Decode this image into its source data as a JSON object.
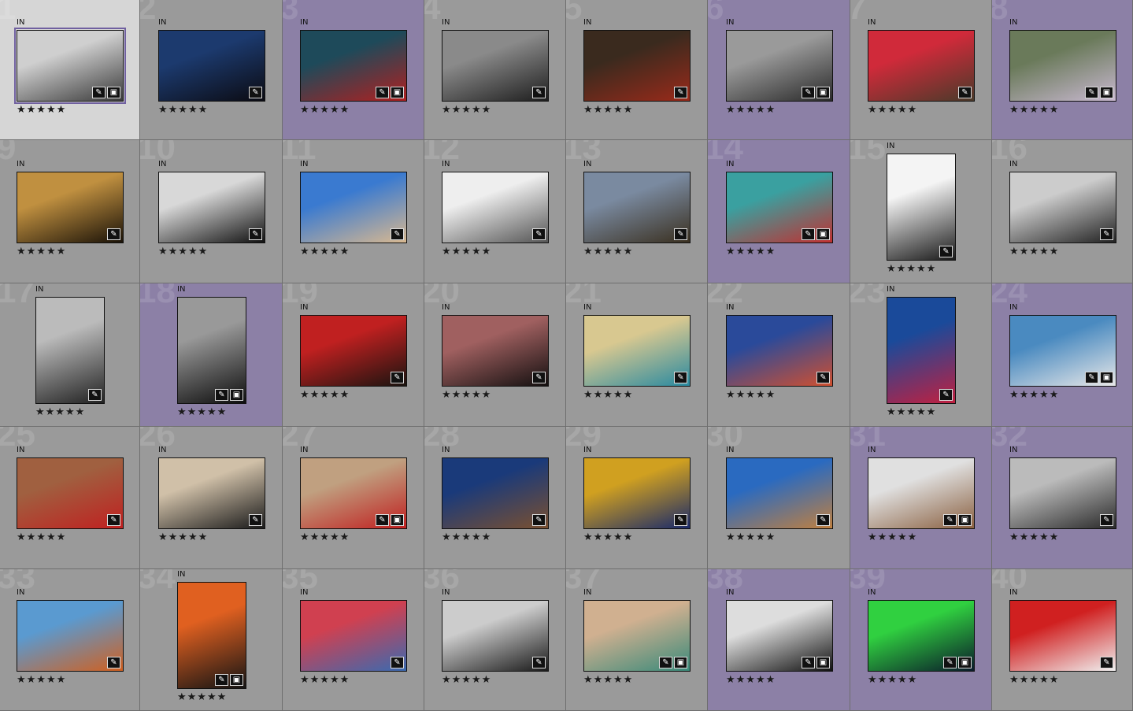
{
  "grid": {
    "columns": 8,
    "cells": [
      {
        "number": "1",
        "tag": "IN",
        "stars": "★★★★★",
        "state": "selected",
        "orientation": "landscape",
        "colors": [
          "#cfcfcf",
          "#3a3a3a"
        ],
        "badges": [
          "edit",
          "crop"
        ]
      },
      {
        "number": "2",
        "tag": "IN",
        "stars": "★★★★★",
        "state": "normal",
        "orientation": "landscape",
        "colors": [
          "#1c3a6e",
          "#0b0b12"
        ],
        "badges": [
          "edit"
        ]
      },
      {
        "number": "3",
        "tag": "IN",
        "stars": "★★★★★",
        "state": "purple",
        "orientation": "landscape",
        "colors": [
          "#1e4a5a",
          "#b02020"
        ],
        "badges": [
          "edit",
          "crop"
        ]
      },
      {
        "number": "4",
        "tag": "IN",
        "stars": "★★★★★",
        "state": "normal",
        "orientation": "landscape",
        "colors": [
          "#8a8a8a",
          "#1e1e1e"
        ],
        "badges": [
          "edit"
        ]
      },
      {
        "number": "5",
        "tag": "IN",
        "stars": "★★★★★",
        "state": "normal",
        "orientation": "landscape",
        "colors": [
          "#3a2a1e",
          "#9a2a1a"
        ],
        "badges": [
          "edit"
        ]
      },
      {
        "number": "6",
        "tag": "IN",
        "stars": "★★★★★",
        "state": "purple",
        "orientation": "landscape",
        "colors": [
          "#9a9a9a",
          "#2a2a2a"
        ],
        "badges": [
          "edit",
          "crop"
        ]
      },
      {
        "number": "7",
        "tag": "IN",
        "stars": "★★★★★",
        "state": "normal",
        "orientation": "landscape",
        "colors": [
          "#d02a3a",
          "#4a3a2a"
        ],
        "badges": [
          "edit"
        ]
      },
      {
        "number": "8",
        "tag": "IN",
        "stars": "★★★★★",
        "state": "purple",
        "orientation": "landscape",
        "colors": [
          "#6a7a5a",
          "#c8b8d0"
        ],
        "badges": [
          "edit",
          "crop"
        ]
      },
      {
        "number": "9",
        "tag": "IN",
        "stars": "★★★★★",
        "state": "normal",
        "orientation": "landscape",
        "colors": [
          "#c09040",
          "#1a1208"
        ],
        "badges": [
          "edit"
        ]
      },
      {
        "number": "10",
        "tag": "IN",
        "stars": "★★★★★",
        "state": "normal",
        "orientation": "landscape",
        "colors": [
          "#d8d8d8",
          "#111111"
        ],
        "badges": [
          "edit"
        ]
      },
      {
        "number": "11",
        "tag": "IN",
        "stars": "★★★★★",
        "state": "normal",
        "orientation": "landscape",
        "colors": [
          "#3a7ad0",
          "#d8b890"
        ],
        "badges": [
          "edit"
        ]
      },
      {
        "number": "12",
        "tag": "IN",
        "stars": "★★★★★",
        "state": "normal",
        "orientation": "landscape",
        "colors": [
          "#eeeeee",
          "#555555"
        ],
        "badges": [
          "edit"
        ]
      },
      {
        "number": "13",
        "tag": "IN",
        "stars": "★★★★★",
        "state": "normal",
        "orientation": "landscape",
        "colors": [
          "#7a8aa0",
          "#3a3020"
        ],
        "badges": [
          "edit"
        ]
      },
      {
        "number": "14",
        "tag": "IN",
        "stars": "★★★★★",
        "state": "purple",
        "orientation": "landscape",
        "colors": [
          "#3aa0a0",
          "#c03030"
        ],
        "badges": [
          "edit",
          "crop"
        ]
      },
      {
        "number": "15",
        "tag": "IN",
        "stars": "★★★★★",
        "state": "normal",
        "orientation": "portrait",
        "colors": [
          "#f4f4f4",
          "#1a1a1a"
        ],
        "badges": [
          "edit"
        ]
      },
      {
        "number": "16",
        "tag": "IN",
        "stars": "★★★★★",
        "state": "normal",
        "orientation": "landscape",
        "colors": [
          "#cccccc",
          "#222222"
        ],
        "badges": [
          "edit"
        ]
      },
      {
        "number": "17",
        "tag": "IN",
        "stars": "★★★★★",
        "state": "normal",
        "orientation": "portrait",
        "colors": [
          "#bbbbbb",
          "#222222"
        ],
        "badges": [
          "edit"
        ]
      },
      {
        "number": "18",
        "tag": "IN",
        "stars": "★★★★★",
        "state": "purple",
        "orientation": "portrait",
        "colors": [
          "#999999",
          "#0e0e0e"
        ],
        "badges": [
          "edit",
          "crop"
        ]
      },
      {
        "number": "19",
        "tag": "IN",
        "stars": "★★★★★",
        "state": "normal",
        "orientation": "landscape",
        "colors": [
          "#c02020",
          "#1a1410"
        ],
        "badges": [
          "edit"
        ]
      },
      {
        "number": "20",
        "tag": "IN",
        "stars": "★★★★★",
        "state": "normal",
        "orientation": "landscape",
        "colors": [
          "#a06060",
          "#141010"
        ],
        "badges": [
          "edit"
        ]
      },
      {
        "number": "21",
        "tag": "IN",
        "stars": "★★★★★",
        "state": "normal",
        "orientation": "landscape",
        "colors": [
          "#d8c890",
          "#2a8aa0"
        ],
        "badges": [
          "edit"
        ]
      },
      {
        "number": "22",
        "tag": "IN",
        "stars": "★★★★★",
        "state": "normal",
        "orientation": "landscape",
        "colors": [
          "#2a4a9a",
          "#d05030"
        ],
        "badges": [
          "edit"
        ]
      },
      {
        "number": "23",
        "tag": "IN",
        "stars": "★★★★★",
        "state": "normal",
        "orientation": "portrait",
        "colors": [
          "#1a4a9a",
          "#c02040"
        ],
        "badges": [
          "edit"
        ]
      },
      {
        "number": "24",
        "tag": "IN",
        "stars": "★★★★★",
        "state": "purple",
        "orientation": "landscape",
        "colors": [
          "#4a8ac0",
          "#e8e8e8"
        ],
        "badges": [
          "edit",
          "crop"
        ]
      },
      {
        "number": "25",
        "tag": "IN",
        "stars": "★★★★★",
        "state": "normal",
        "orientation": "landscape",
        "colors": [
          "#a06040",
          "#c02020"
        ],
        "badges": [
          "edit"
        ]
      },
      {
        "number": "26",
        "tag": "IN",
        "stars": "★★★★★",
        "state": "normal",
        "orientation": "landscape",
        "colors": [
          "#d0c0a8",
          "#1a1a1a"
        ],
        "badges": [
          "edit"
        ]
      },
      {
        "number": "27",
        "tag": "IN",
        "stars": "★★★★★",
        "state": "normal",
        "orientation": "landscape",
        "colors": [
          "#c0a080",
          "#c02020"
        ],
        "badges": [
          "edit",
          "crop"
        ]
      },
      {
        "number": "28",
        "tag": "IN",
        "stars": "★★★★★",
        "state": "normal",
        "orientation": "landscape",
        "colors": [
          "#1a3a7a",
          "#7a5030"
        ],
        "badges": [
          "edit"
        ]
      },
      {
        "number": "29",
        "tag": "IN",
        "stars": "★★★★★",
        "state": "normal",
        "orientation": "landscape",
        "colors": [
          "#d0a020",
          "#1a2a6a"
        ],
        "badges": [
          "edit"
        ]
      },
      {
        "number": "30",
        "tag": "IN",
        "stars": "★★★★★",
        "state": "normal",
        "orientation": "landscape",
        "colors": [
          "#2a6ac0",
          "#c08040"
        ],
        "badges": [
          "edit"
        ]
      },
      {
        "number": "31",
        "tag": "IN",
        "stars": "★★★★★",
        "state": "purple",
        "orientation": "landscape",
        "colors": [
          "#e0e0e0",
          "#8a6040"
        ],
        "badges": [
          "edit",
          "crop"
        ]
      },
      {
        "number": "32",
        "tag": "IN",
        "stars": "★★★★★",
        "state": "purple",
        "orientation": "landscape",
        "colors": [
          "#bbbbbb",
          "#2a2a2a"
        ],
        "badges": [
          "edit"
        ]
      },
      {
        "number": "33",
        "tag": "IN",
        "stars": "★★★★★",
        "state": "normal",
        "orientation": "landscape",
        "colors": [
          "#5a9ad0",
          "#d06020"
        ],
        "badges": [
          "edit"
        ]
      },
      {
        "number": "34",
        "tag": "IN",
        "stars": "★★★★★",
        "state": "normal",
        "orientation": "portrait",
        "colors": [
          "#e06020",
          "#141414"
        ],
        "badges": [
          "edit",
          "crop"
        ]
      },
      {
        "number": "35",
        "tag": "IN",
        "stars": "★★★★★",
        "state": "normal",
        "orientation": "landscape",
        "colors": [
          "#d04050",
          "#3a6ab0"
        ],
        "badges": [
          "edit"
        ]
      },
      {
        "number": "36",
        "tag": "IN",
        "stars": "★★★★★",
        "state": "normal",
        "orientation": "landscape",
        "colors": [
          "#cccccc",
          "#1a1a1a"
        ],
        "badges": [
          "edit"
        ]
      },
      {
        "number": "37",
        "tag": "IN",
        "stars": "★★★★★",
        "state": "normal",
        "orientation": "landscape",
        "colors": [
          "#d0b090",
          "#3a8a7a"
        ],
        "badges": [
          "edit",
          "crop"
        ]
      },
      {
        "number": "38",
        "tag": "IN",
        "stars": "★★★★★",
        "state": "purple",
        "orientation": "landscape",
        "colors": [
          "#dddddd",
          "#111111"
        ],
        "badges": [
          "edit",
          "crop"
        ]
      },
      {
        "number": "39",
        "tag": "IN",
        "stars": "★★★★★",
        "state": "purple",
        "orientation": "landscape",
        "colors": [
          "#30d040",
          "#0a1a2a"
        ],
        "badges": [
          "edit",
          "crop"
        ]
      },
      {
        "number": "40",
        "tag": "IN",
        "stars": "★★★★★",
        "state": "normal",
        "orientation": "landscape",
        "colors": [
          "#d02020",
          "#f0f0f0"
        ],
        "badges": [
          "edit"
        ]
      }
    ]
  },
  "badge_icons": {
    "edit": "edit-icon",
    "crop": "crop-icon"
  },
  "colors": {
    "cell_normal": "#9a9a9a",
    "cell_selected": "#d6d6d6",
    "cell_purple": "#8c80a6"
  }
}
